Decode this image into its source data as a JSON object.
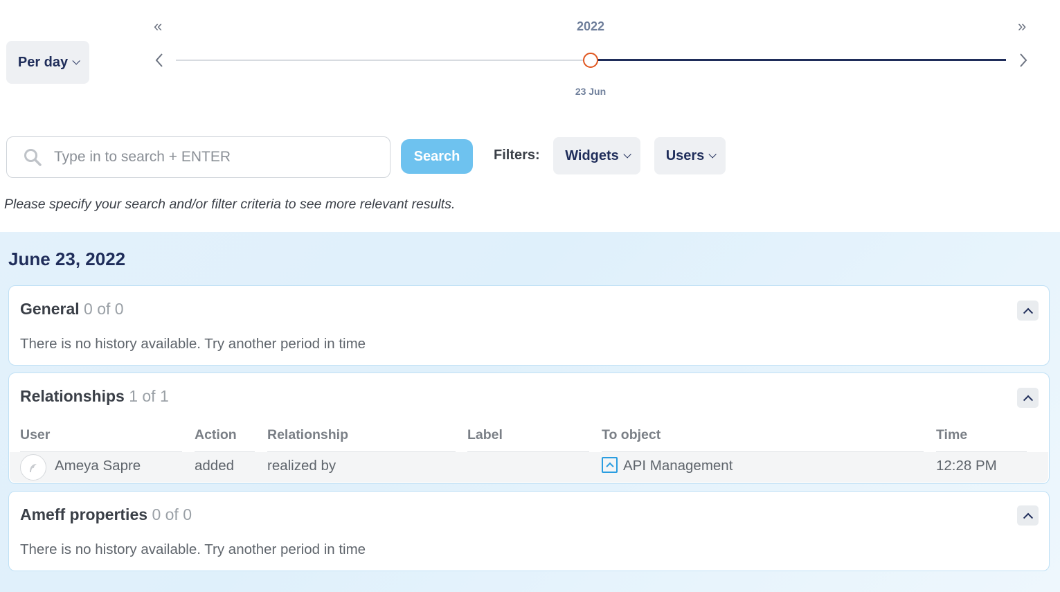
{
  "timeline": {
    "period_label": "Per day",
    "year": "2022",
    "selected_date": "23 Jun",
    "first_glyph": "«",
    "last_glyph": "»",
    "prev_glyph": "‹",
    "next_glyph": "›",
    "position": 0.5
  },
  "search": {
    "placeholder": "Type in to search + ENTER",
    "value": "",
    "button_label": "Search"
  },
  "filters": {
    "label": "Filters:",
    "widgets_label": "Widgets",
    "users_label": "Users"
  },
  "hint": "Please specify your search and/or filter criteria to see more relevant results.",
  "day_title": "June 23, 2022",
  "sections": {
    "general": {
      "name": "General",
      "count": "0 of 0",
      "empty": "There is no history available. Try another period in time"
    },
    "relationships": {
      "name": "Relationships",
      "count": "1 of 1",
      "columns": {
        "user": "User",
        "action": "Action",
        "relationship": "Relationship",
        "label": "Label",
        "to_object": "To object",
        "time": "Time"
      },
      "rows": [
        {
          "user": "Ameya Sapre",
          "action": "added",
          "relationship": "realized by",
          "label": "",
          "to_object": "API Management",
          "time": "12:28 PM"
        }
      ]
    },
    "ameff": {
      "name": "Ameff properties",
      "count": "0 of 0",
      "empty": "There is no history available. Try another period in time"
    }
  },
  "colors": {
    "accent_navy": "#1f2d5a",
    "knob_orange": "#e0561f",
    "search_button": "#6ec2ef",
    "object_icon": "#2a9de0"
  },
  "icons": {
    "search": "search-icon",
    "collapse": "chevron-up-icon",
    "object": "application-component-icon",
    "avatar": "user-avatar-icon"
  }
}
